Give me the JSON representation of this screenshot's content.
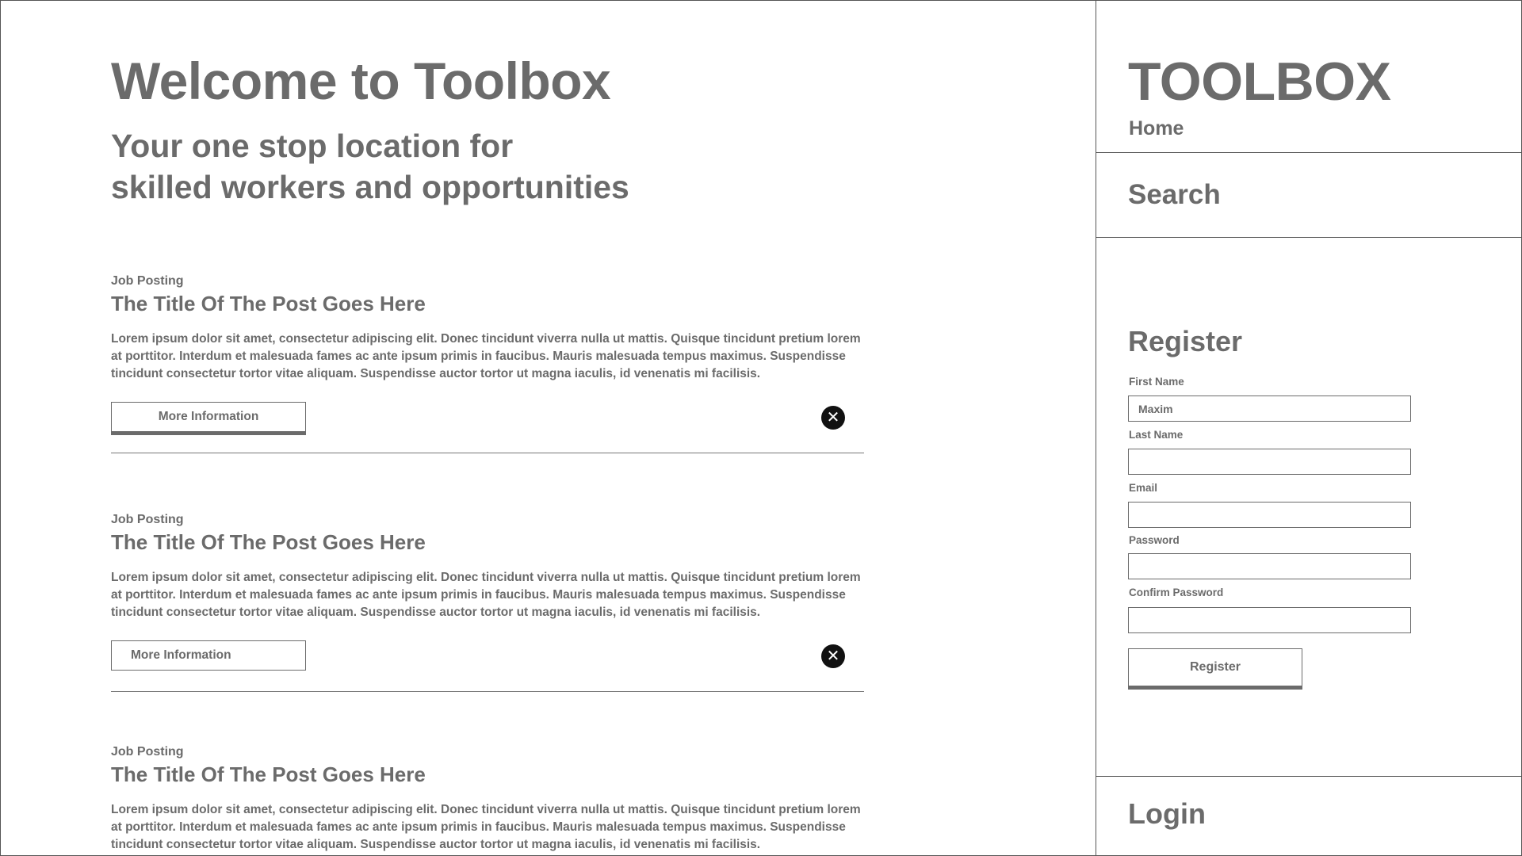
{
  "hero": {
    "title": "Welcome to Toolbox",
    "tagline_lines": [
      "Your one stop location for",
      "skilled workers and opportunities"
    ]
  },
  "posts": [
    {
      "label": "Job Posting",
      "title": "The Title Of The Post Goes Here",
      "body": "Lorem ipsum dolor sit amet, consectetur adipiscing elit. Donec tincidunt viverra nulla ut mattis. Quisque tincidunt pretium lorem at porttitor. Interdum et malesuada fames ac ante ipsum primis in faucibus. Mauris malesuada tempus maximus. Suspendisse tincidunt consectetur tortor vitae aliquam. Suspendisse auctor tortor ut magna iaculis, id venenatis mi facilisis.",
      "button_label": "More Information",
      "close_icon": "close-icon"
    },
    {
      "label": "Job Posting",
      "title": "The Title Of The Post Goes Here",
      "body": "Lorem ipsum dolor sit amet, consectetur adipiscing elit. Donec tincidunt viverra nulla ut mattis. Quisque tincidunt pretium lorem at porttitor. Interdum et malesuada fames ac ante ipsum primis in faucibus. Mauris malesuada tempus maximus. Suspendisse tincidunt consectetur tortor vitae aliquam. Suspendisse auctor tortor ut magna iaculis, id venenatis mi facilisis.",
      "button_label": "More Information",
      "close_icon": "close-icon"
    },
    {
      "label": "Job Posting",
      "title": "The Title Of The Post Goes Here",
      "body": "Lorem ipsum dolor sit amet, consectetur adipiscing elit. Donec tincidunt viverra nulla ut mattis. Quisque tincidunt pretium lorem at porttitor. Interdum et malesuada fames ac ante ipsum primis in faucibus. Mauris malesuada tempus maximus. Suspendisse tincidunt consectetur tortor vitae aliquam. Suspendisse auctor tortor ut magna iaculis, id venenatis mi facilisis."
    }
  ],
  "sidebar": {
    "brand": "TOOLBOX",
    "home": "Home",
    "search": "Search",
    "login": "Login"
  },
  "register": {
    "title": "Register",
    "fields": [
      {
        "label": "First Name",
        "value": "Maxim"
      },
      {
        "label": "Last Name",
        "value": ""
      },
      {
        "label": "Email",
        "value": ""
      },
      {
        "label": "Password",
        "value": ""
      },
      {
        "label": "Confirm Password",
        "value": ""
      }
    ],
    "button_label": "Register"
  },
  "colors": {
    "text": "#6b6b6b",
    "border": "#555555",
    "close_button": "#111111",
    "background": "#ffffff"
  }
}
